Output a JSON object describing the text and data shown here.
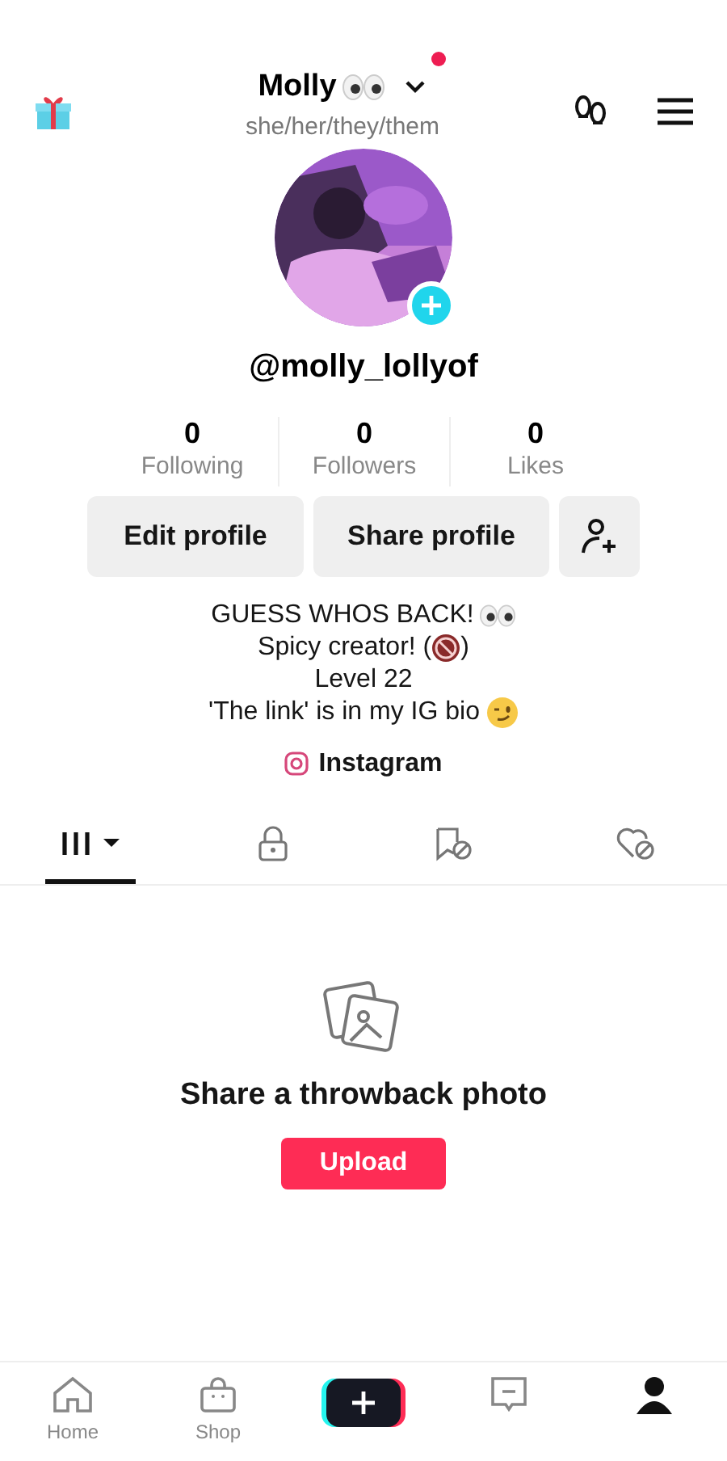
{
  "header": {
    "name": "Molly",
    "notification": true,
    "pronouns": "she/her/they/them"
  },
  "profile": {
    "username": "@molly_lollyof"
  },
  "stats": [
    {
      "value": "0",
      "label": "Following"
    },
    {
      "value": "0",
      "label": "Followers"
    },
    {
      "value": "0",
      "label": "Likes"
    }
  ],
  "buttons": [
    "Edit profile",
    "Share profile"
  ],
  "bio": [
    {
      "text": "GUESS WHOS BACK!",
      "kind": "eyes"
    },
    {
      "text": "Spicy creator! (",
      "after": ")",
      "kind": "adult"
    },
    {
      "text": "Level 22",
      "kind": "plain"
    },
    {
      "text": "'The link' is in my IG bio",
      "kind": "wink"
    }
  ],
  "link": {
    "label": "Instagram"
  },
  "tabs": [
    {
      "kind": "videos",
      "selected": true
    },
    {
      "kind": "private",
      "selected": false
    },
    {
      "kind": "saved",
      "selected": false
    },
    {
      "kind": "liked",
      "selected": false
    }
  ],
  "empty_state": {
    "title": "Share a throwback photo",
    "button": "Upload"
  },
  "nav": [
    {
      "kind": "home",
      "label": "Home",
      "selected": false
    },
    {
      "kind": "shop",
      "label": "Shop",
      "selected": false
    },
    {
      "kind": "create"
    },
    {
      "kind": "inbox",
      "selected": false
    },
    {
      "kind": "profile",
      "selected": true
    }
  ]
}
